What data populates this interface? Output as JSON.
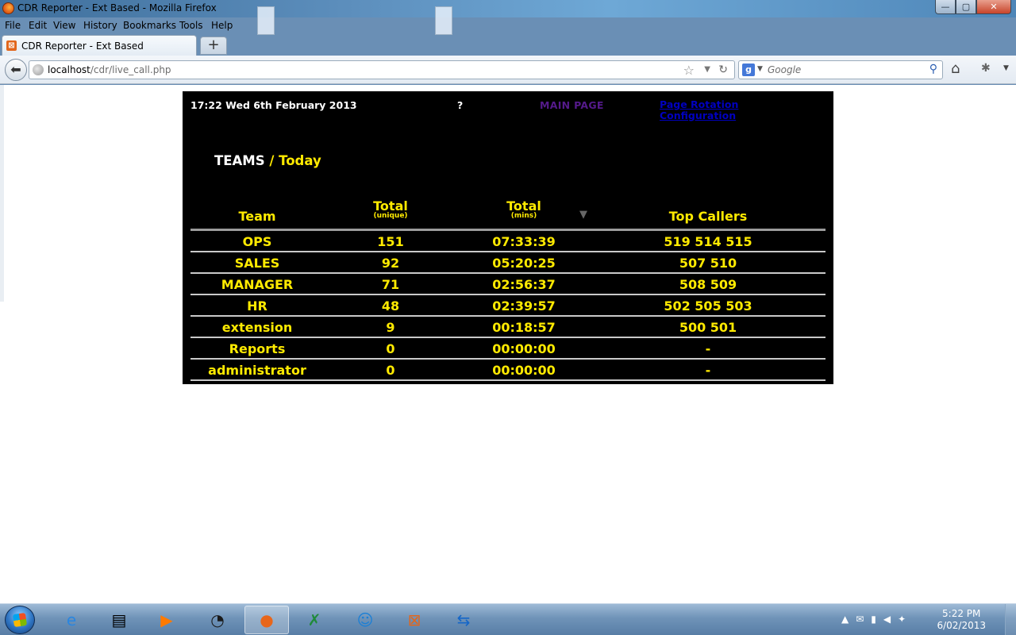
{
  "window": {
    "title": "CDR Reporter - Ext Based - Mozilla Firefox",
    "min": "—",
    "max": "▢",
    "close": "✕"
  },
  "menu": [
    "File",
    "Edit",
    "View",
    "History",
    "Bookmarks",
    "Tools",
    "Help"
  ],
  "tab": {
    "label": "CDR Reporter - Ext Based",
    "new_tab": "+"
  },
  "nav": {
    "url_host": "localhost",
    "url_path": "/cdr/live_call.php",
    "search_placeholder": "Google"
  },
  "page": {
    "datetime": "17:22 Wed 6th February 2013",
    "help": "?",
    "main_page": "MAIN PAGE",
    "rotation_line1": "Page Rotation",
    "rotation_line2": "Configuration",
    "title_part1": "TEAMS",
    "title_sep": "/",
    "title_part2": "Today",
    "columns": {
      "team": "Team",
      "total_unique": "Total",
      "total_unique_sub": "(unique)",
      "total_mins": "Total",
      "total_mins_sub": "(mins)",
      "top_callers": "Top Callers"
    },
    "rows": [
      {
        "team": "OPS",
        "total": "151",
        "mins": "07:33:39",
        "callers": "519 514 515"
      },
      {
        "team": "SALES",
        "total": "92",
        "mins": "05:20:25",
        "callers": "507 510"
      },
      {
        "team": "MANAGER",
        "total": "71",
        "mins": "02:56:37",
        "callers": "508 509"
      },
      {
        "team": "HR",
        "total": "48",
        "mins": "02:39:57",
        "callers": "502 505 503"
      },
      {
        "team": "extension",
        "total": "9",
        "mins": "00:18:57",
        "callers": "500 501"
      },
      {
        "team": "Reports",
        "total": "0",
        "mins": "00:00:00",
        "callers": "-"
      },
      {
        "team": "administrator",
        "total": "0",
        "mins": "00:00:00",
        "callers": "-"
      }
    ]
  },
  "taskbar": {
    "time": "5:22 PM",
    "date": "6/02/2013"
  },
  "colors": {
    "panel_bg": "#000000",
    "highlight_yellow": "#ffea00",
    "visited_link": "#551a8b",
    "link": "#0000c0"
  }
}
